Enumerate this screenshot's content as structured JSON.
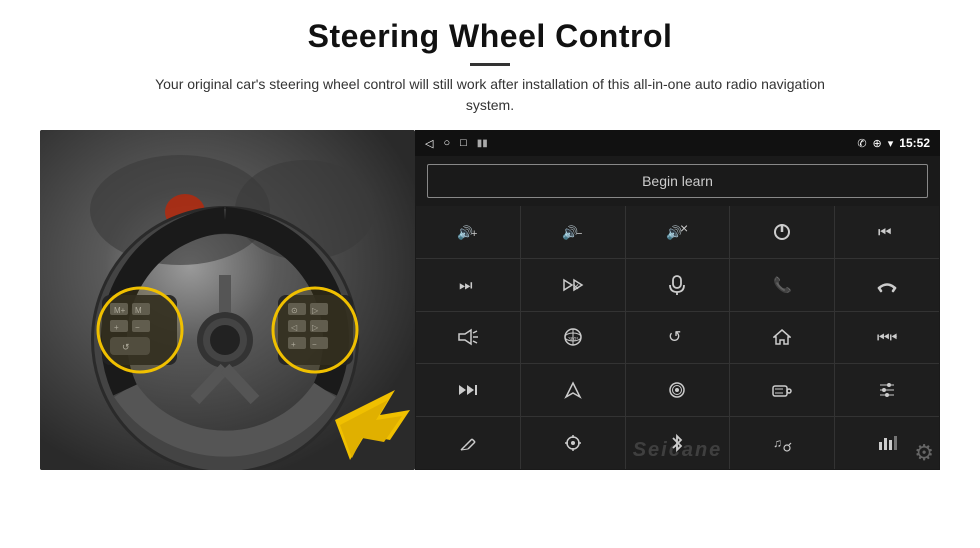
{
  "header": {
    "title": "Steering Wheel Control",
    "subtitle": "Your original car's steering wheel control will still work after installation of this all-in-one auto radio navigation system."
  },
  "android_ui": {
    "status_bar": {
      "nav_back": "◁",
      "nav_home": "○",
      "nav_recent": "□",
      "signal_icon": "▮▮",
      "phone_icon": "📞",
      "location_icon": "⊕",
      "wifi_icon": "▾",
      "time": "15:52"
    },
    "begin_learn_label": "Begin learn",
    "watermark": "Seicane",
    "controls": [
      {
        "icon": "🔊+",
        "label": "vol-up"
      },
      {
        "icon": "🔊−",
        "label": "vol-down"
      },
      {
        "icon": "🔇",
        "label": "mute"
      },
      {
        "icon": "⏻",
        "label": "power"
      },
      {
        "icon": "⏮",
        "label": "prev-track"
      },
      {
        "icon": "⏭",
        "label": "next-track"
      },
      {
        "icon": "✂⏭",
        "label": "skip-forward"
      },
      {
        "icon": "🎤",
        "label": "mic"
      },
      {
        "icon": "📞",
        "label": "call"
      },
      {
        "icon": "↩",
        "label": "hang-up"
      },
      {
        "icon": "📢",
        "label": "horn"
      },
      {
        "icon": "⊙",
        "label": "360-view"
      },
      {
        "icon": "↺",
        "label": "back"
      },
      {
        "icon": "⌂",
        "label": "home"
      },
      {
        "icon": "⏮⏮",
        "label": "rewind"
      },
      {
        "icon": "⏭⏭",
        "label": "fast-forward"
      },
      {
        "icon": "▶",
        "label": "navigate"
      },
      {
        "icon": "⏺",
        "label": "eject"
      },
      {
        "icon": "📻",
        "label": "radio"
      },
      {
        "icon": "≡⊞",
        "label": "eq"
      },
      {
        "icon": "✏",
        "label": "edit"
      },
      {
        "icon": "⊙",
        "label": "settings2"
      },
      {
        "icon": "✱",
        "label": "bluetooth"
      },
      {
        "icon": "♫",
        "label": "music-settings"
      },
      {
        "icon": "▐▐▐",
        "label": "equalizer"
      }
    ],
    "settings_icon": "⚙"
  }
}
